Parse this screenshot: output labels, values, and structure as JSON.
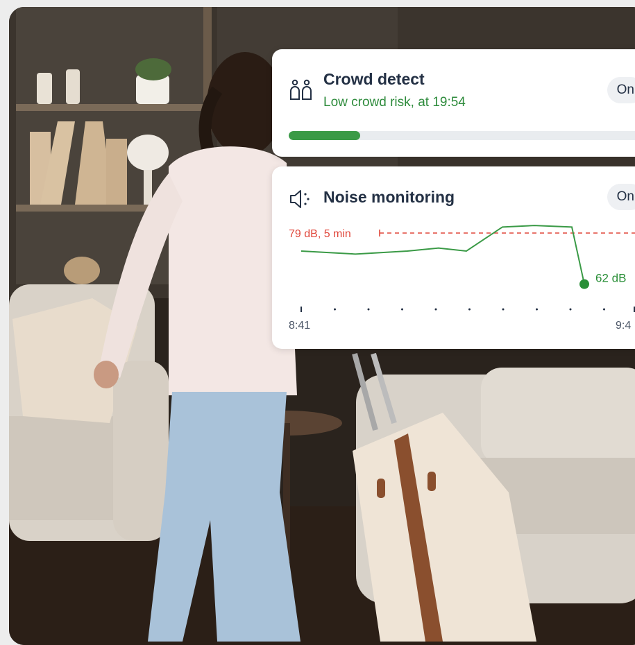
{
  "crowd": {
    "title": "Crowd detect",
    "status": "Low crowd risk, at 19:54",
    "toggle": "On",
    "risk_level": 0.19,
    "icon": "people-icon"
  },
  "noise": {
    "title": "Noise monitoring",
    "toggle": "On",
    "icon": "speaker-sound-icon",
    "threshold_label": "79 dB, 5 min",
    "current_label": "62 dB",
    "time_start": "8:41",
    "time_end": "9:4"
  },
  "chart_data": {
    "type": "line",
    "series": [
      {
        "values": [
          73,
          72,
          73,
          74,
          73,
          81,
          81.5,
          81,
          62
        ]
      }
    ],
    "threshold": 79,
    "ylim": [
      55,
      85
    ],
    "x_labels": [
      "8:41",
      "9:4"
    ],
    "threshold_label": "79 dB, 5 min",
    "last_point_label": "62 dB",
    "colors": {
      "line": "#3a9a46",
      "threshold": "#e0463a",
      "point": "#2a8f38"
    }
  },
  "colors": {
    "accent_green": "#3a9a46",
    "title_text": "#233044",
    "alert_red": "#e0463a"
  }
}
